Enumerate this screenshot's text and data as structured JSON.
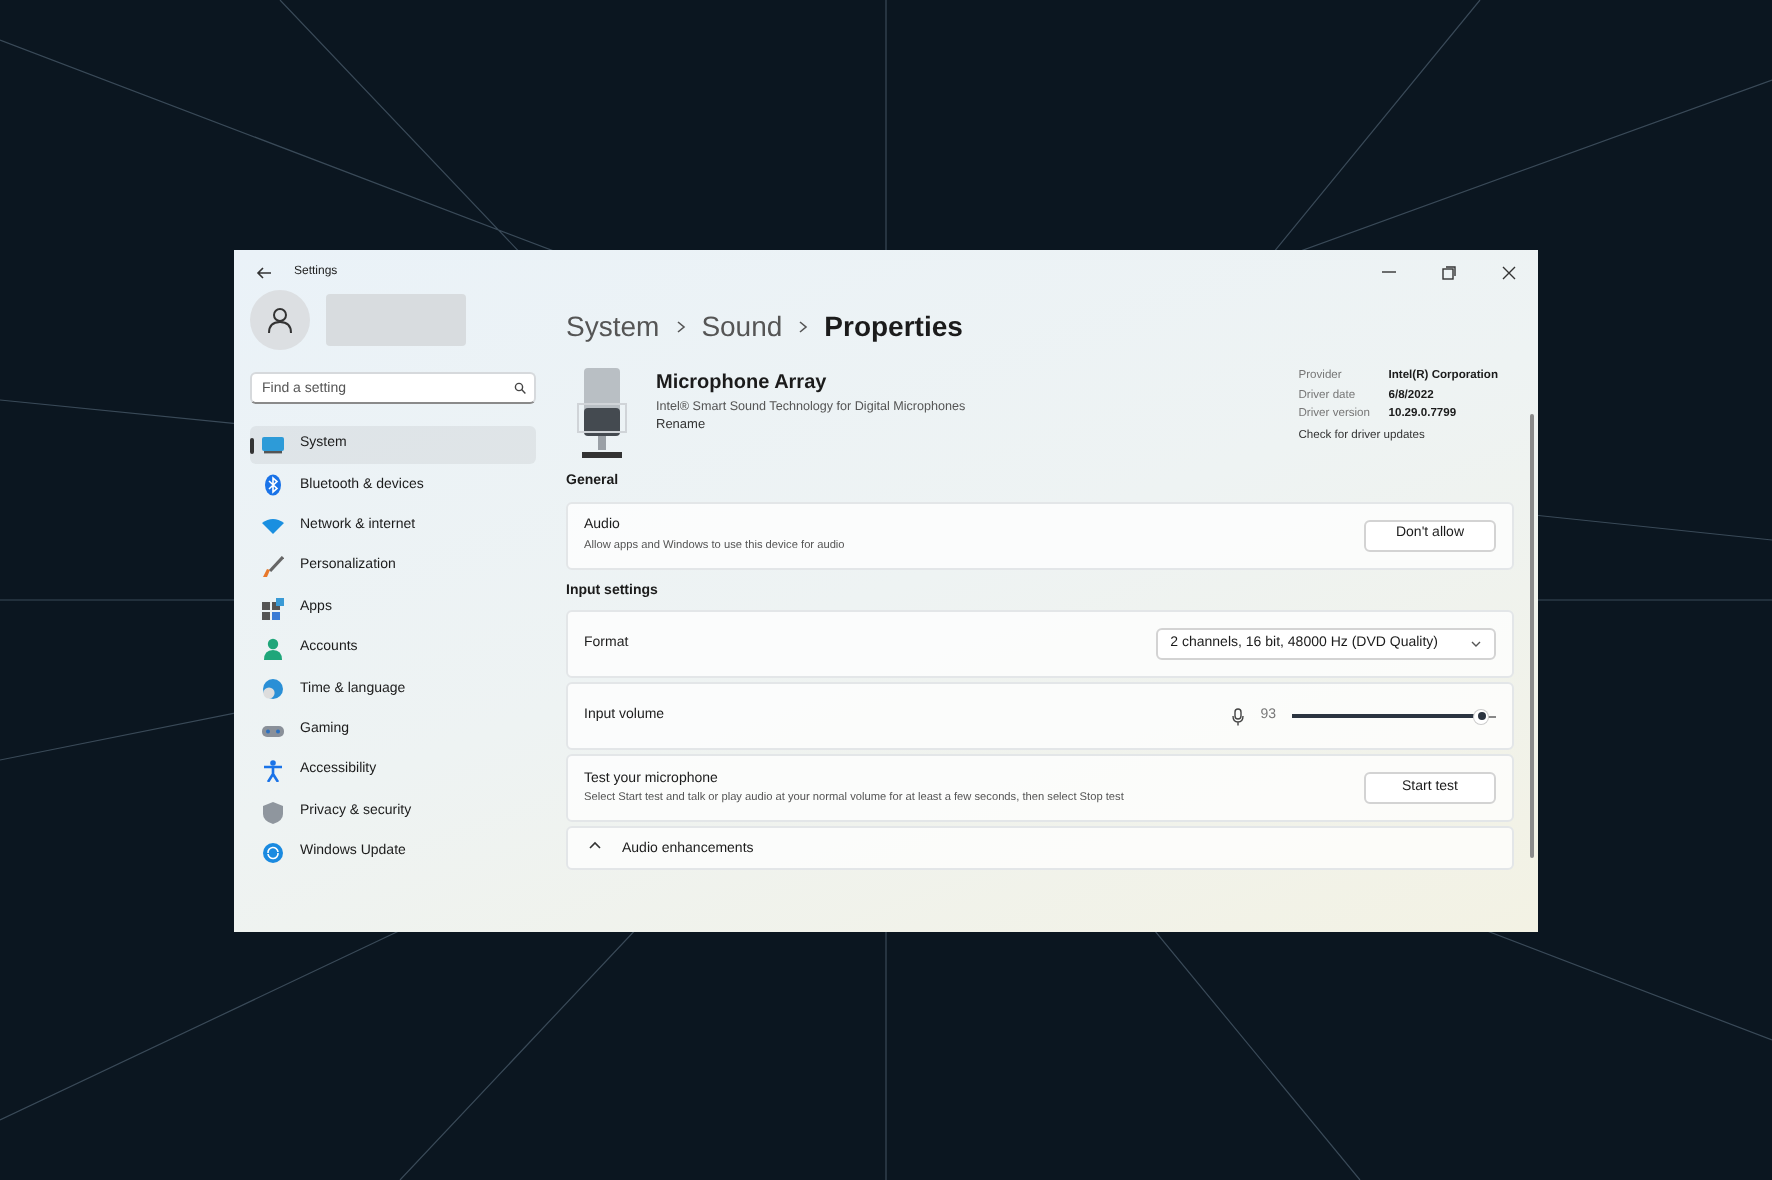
{
  "window": {
    "title": "Settings"
  },
  "sidebar": {
    "search": {
      "placeholder": "Find a setting"
    },
    "items": [
      {
        "label": "System",
        "selected": true
      },
      {
        "label": "Bluetooth & devices",
        "selected": false
      },
      {
        "label": "Network & internet",
        "selected": false
      },
      {
        "label": "Personalization",
        "selected": false
      },
      {
        "label": "Apps",
        "selected": false
      },
      {
        "label": "Accounts",
        "selected": false
      },
      {
        "label": "Time & language",
        "selected": false
      },
      {
        "label": "Gaming",
        "selected": false
      },
      {
        "label": "Accessibility",
        "selected": false
      },
      {
        "label": "Privacy & security",
        "selected": false
      },
      {
        "label": "Windows Update",
        "selected": false
      }
    ]
  },
  "breadcrumb": [
    "System",
    "Sound",
    "Properties"
  ],
  "device": {
    "name": "Microphone Array",
    "description": "Intel® Smart Sound Technology for Digital Microphones",
    "rename": "Rename",
    "details": [
      {
        "label": "Provider",
        "value": "Intel(R) Corporation"
      },
      {
        "label": "Driver date",
        "value": "6/8/2022"
      },
      {
        "label": "Driver version",
        "value": "10.29.0.7799"
      }
    ],
    "update_link": "Check for driver updates"
  },
  "sections": [
    {
      "heading": "General",
      "rows": [
        {
          "kind": "button",
          "title": "Audio",
          "subtitle": "Allow apps and Windows to use this device for audio",
          "action": "Don't allow"
        }
      ]
    },
    {
      "heading": "Input settings",
      "rows": [
        {
          "kind": "dropdown",
          "title": "Format",
          "value": "2 channels, 16 bit, 48000 Hz (DVD Quality)"
        },
        {
          "kind": "slider",
          "title": "Input volume",
          "reading": "93",
          "level": 0.93
        },
        {
          "kind": "button",
          "title": "Test your microphone",
          "subtitle": "Select Start test and talk or play audio at your normal volume for at least a few seconds, then select Stop test",
          "action": "Start test"
        },
        {
          "kind": "expander",
          "title": "Audio enhancements"
        }
      ]
    }
  ]
}
